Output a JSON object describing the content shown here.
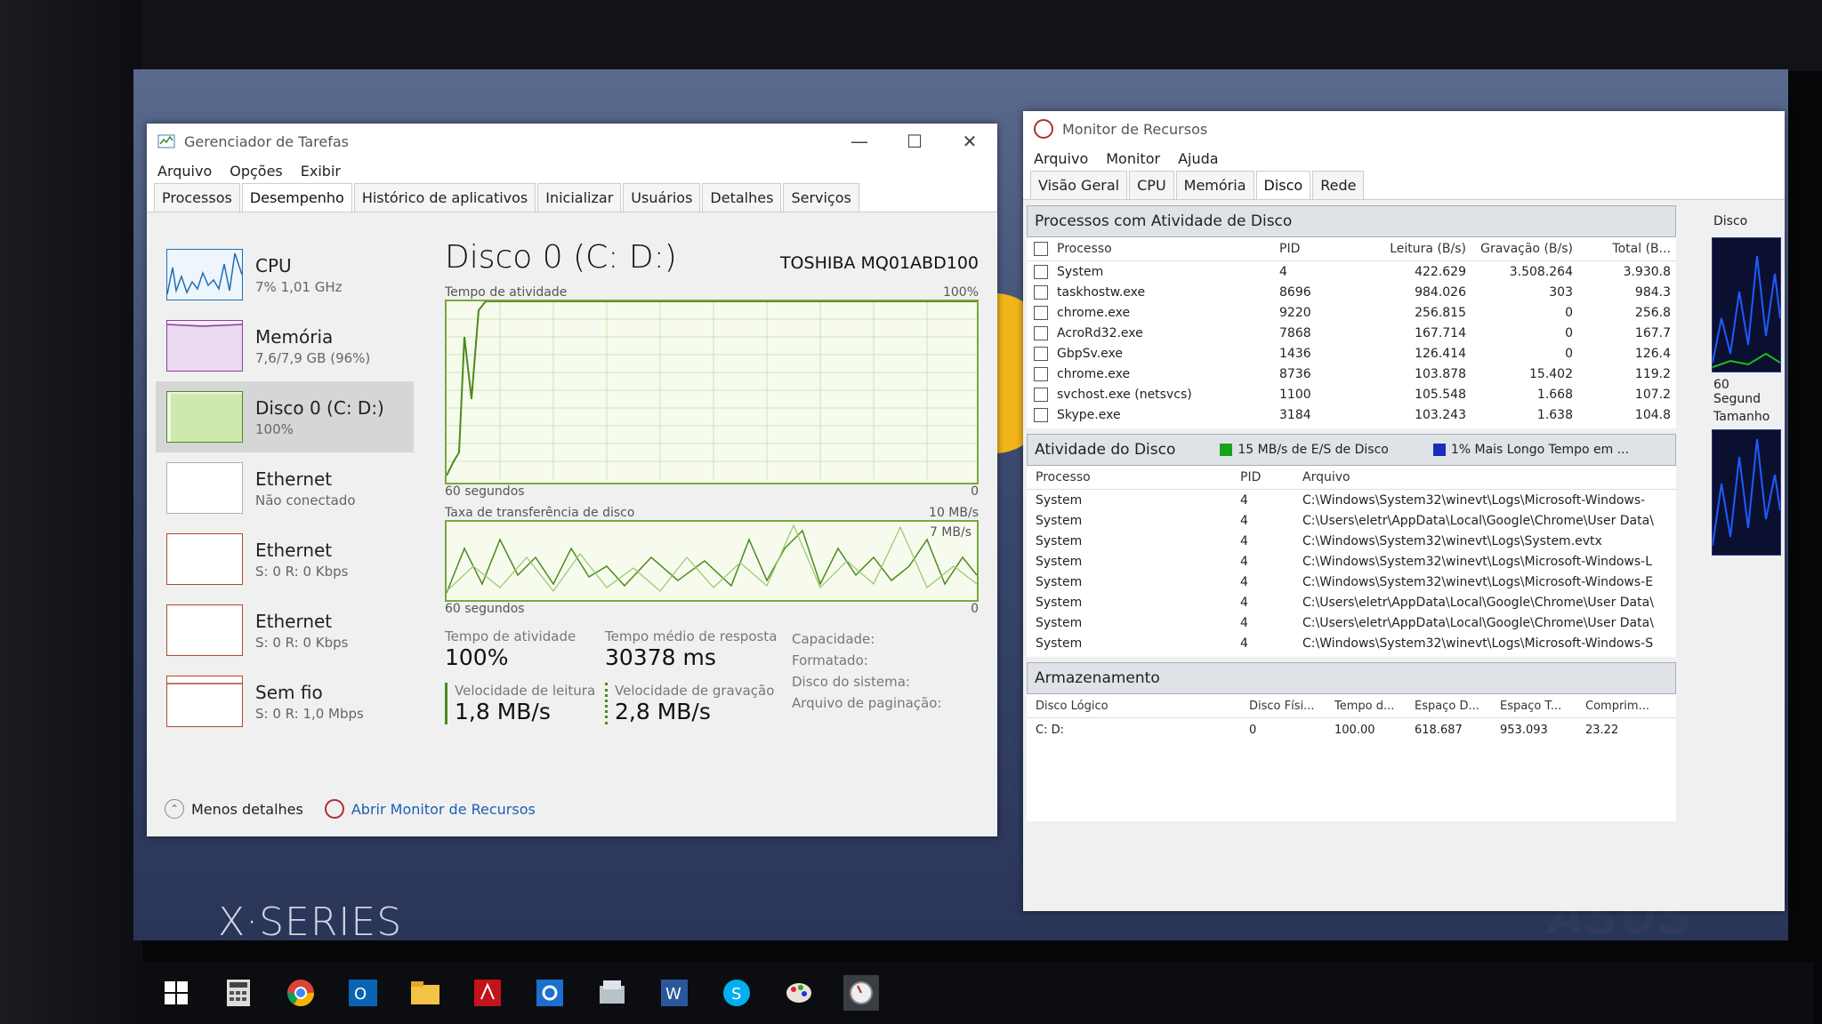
{
  "task_manager": {
    "title": "Gerenciador de Tarefas",
    "menu": [
      "Arquivo",
      "Opções",
      "Exibir"
    ],
    "tabs": [
      "Processos",
      "Desempenho",
      "Histórico de aplicativos",
      "Inicializar",
      "Usuários",
      "Detalhes",
      "Serviços"
    ],
    "active_tab": "Desempenho",
    "sidebar": [
      {
        "name": "CPU",
        "sub": "7% 1,01 GHz",
        "color": "#1f6fb5"
      },
      {
        "name": "Memória",
        "sub": "7,6/7,9 GB (96%)",
        "color": "#8b3f9b"
      },
      {
        "name": "Disco 0 (C: D:)",
        "sub": "100%",
        "color": "#4d8a1c"
      },
      {
        "name": "Ethernet",
        "sub": "Não conectado",
        "color": "#b0b0b0"
      },
      {
        "name": "Ethernet",
        "sub": "S: 0 R: 0 Kbps",
        "color": "#b04a2a"
      },
      {
        "name": "Ethernet",
        "sub": "S: 0 R: 0 Kbps",
        "color": "#b04a2a"
      },
      {
        "name": "Sem fio",
        "sub": "S: 0 R: 1,0 Mbps",
        "color": "#b04a2a"
      }
    ],
    "disk_title": "Disco 0 (C: D:)",
    "disk_model": "TOSHIBA MQ01ABD100",
    "graph1": {
      "label": "Tempo de atividade",
      "max": "100%",
      "time": "60 segundos",
      "min": "0"
    },
    "graph2": {
      "label": "Taxa de transferência de disco",
      "max": "10 MB/s",
      "inner": "7 MB/s",
      "time": "60 segundos",
      "min": "0"
    },
    "stats": {
      "active_label": "Tempo de atividade",
      "active_val": "100%",
      "resp_label": "Tempo médio de resposta",
      "resp_val": "30378 ms",
      "read_label": "Velocidade de leitura",
      "read_val": "1,8 MB/s",
      "write_label": "Velocidade de gravação",
      "write_val": "2,8 MB/s",
      "capacity": "Capacidade:",
      "formatted": "Formatado:",
      "system_disk": "Disco do sistema:",
      "pagefile": "Arquivo de paginação:"
    },
    "footer_less": "Menos detalhes",
    "footer_link": "Abrir Monitor de Recursos"
  },
  "resource_monitor": {
    "title": "Monitor de Recursos",
    "menu": [
      "Arquivo",
      "Monitor",
      "Ajuda"
    ],
    "tabs": [
      "Visão Geral",
      "CPU",
      "Memória",
      "Disco",
      "Rede"
    ],
    "active_tab": "Disco",
    "proc_section": "Processos com Atividade de Disco",
    "proc_cols": [
      "Processo",
      "PID",
      "Leitura (B/s)",
      "Gravação (B/s)",
      "Total (B..."
    ],
    "proc_rows": [
      [
        "System",
        "4",
        "422.629",
        "3.508.264",
        "3.930.8"
      ],
      [
        "taskhostw.exe",
        "8696",
        "984.026",
        "303",
        "984.3"
      ],
      [
        "chrome.exe",
        "9220",
        "256.815",
        "0",
        "256.8"
      ],
      [
        "AcroRd32.exe",
        "7868",
        "167.714",
        "0",
        "167.7"
      ],
      [
        "GbpSv.exe",
        "1436",
        "126.414",
        "0",
        "126.4"
      ],
      [
        "chrome.exe",
        "8736",
        "103.878",
        "15.402",
        "119.2"
      ],
      [
        "svchost.exe (netsvcs)",
        "1100",
        "105.548",
        "1.668",
        "107.2"
      ],
      [
        "Skype.exe",
        "3184",
        "103.243",
        "1.638",
        "104.8"
      ]
    ],
    "disk_section": "Atividade do Disco",
    "legend_io": "15 MB/s de E/S de Disco",
    "legend_time": "1% Mais Longo Tempo em ...",
    "disk_cols": [
      "Processo",
      "PID",
      "Arquivo"
    ],
    "disk_rows": [
      [
        "System",
        "4",
        "C:\\Windows\\System32\\winevt\\Logs\\Microsoft-Windows-"
      ],
      [
        "System",
        "4",
        "C:\\Users\\eletr\\AppData\\Local\\Google\\Chrome\\User Data\\"
      ],
      [
        "System",
        "4",
        "C:\\Windows\\System32\\winevt\\Logs\\System.evtx"
      ],
      [
        "System",
        "4",
        "C:\\Windows\\System32\\winevt\\Logs\\Microsoft-Windows-L"
      ],
      [
        "System",
        "4",
        "C:\\Windows\\System32\\winevt\\Logs\\Microsoft-Windows-E"
      ],
      [
        "System",
        "4",
        "C:\\Users\\eletr\\AppData\\Local\\Google\\Chrome\\User Data\\"
      ],
      [
        "System",
        "4",
        "C:\\Users\\eletr\\AppData\\Local\\Google\\Chrome\\User Data\\"
      ],
      [
        "System",
        "4",
        "C:\\Windows\\System32\\winevt\\Logs\\Microsoft-Windows-S"
      ]
    ],
    "storage_section": "Armazenamento",
    "storage_cols": [
      "Disco Lógico",
      "Disco Físi...",
      "Tempo d...",
      "Espaço D...",
      "Espaço T...",
      "Comprim..."
    ],
    "storage_row": [
      "C: D:",
      "0",
      "100.00",
      "618.687",
      "953.093",
      "23.22"
    ],
    "side_label": "Disco",
    "side_time": "60 Segund",
    "side_size": "Tamanho"
  },
  "desktop": {
    "brand": "X·SERIES",
    "logo": "ASUS"
  },
  "taskbar_icons": [
    "windows-start-icon",
    "calculator-icon",
    "chrome-icon",
    "outlook-icon",
    "file-explorer-icon",
    "acrobat-icon",
    "settings-icon",
    "app-icon",
    "word-icon",
    "skype-icon",
    "paint-icon",
    "resource-monitor-icon"
  ]
}
